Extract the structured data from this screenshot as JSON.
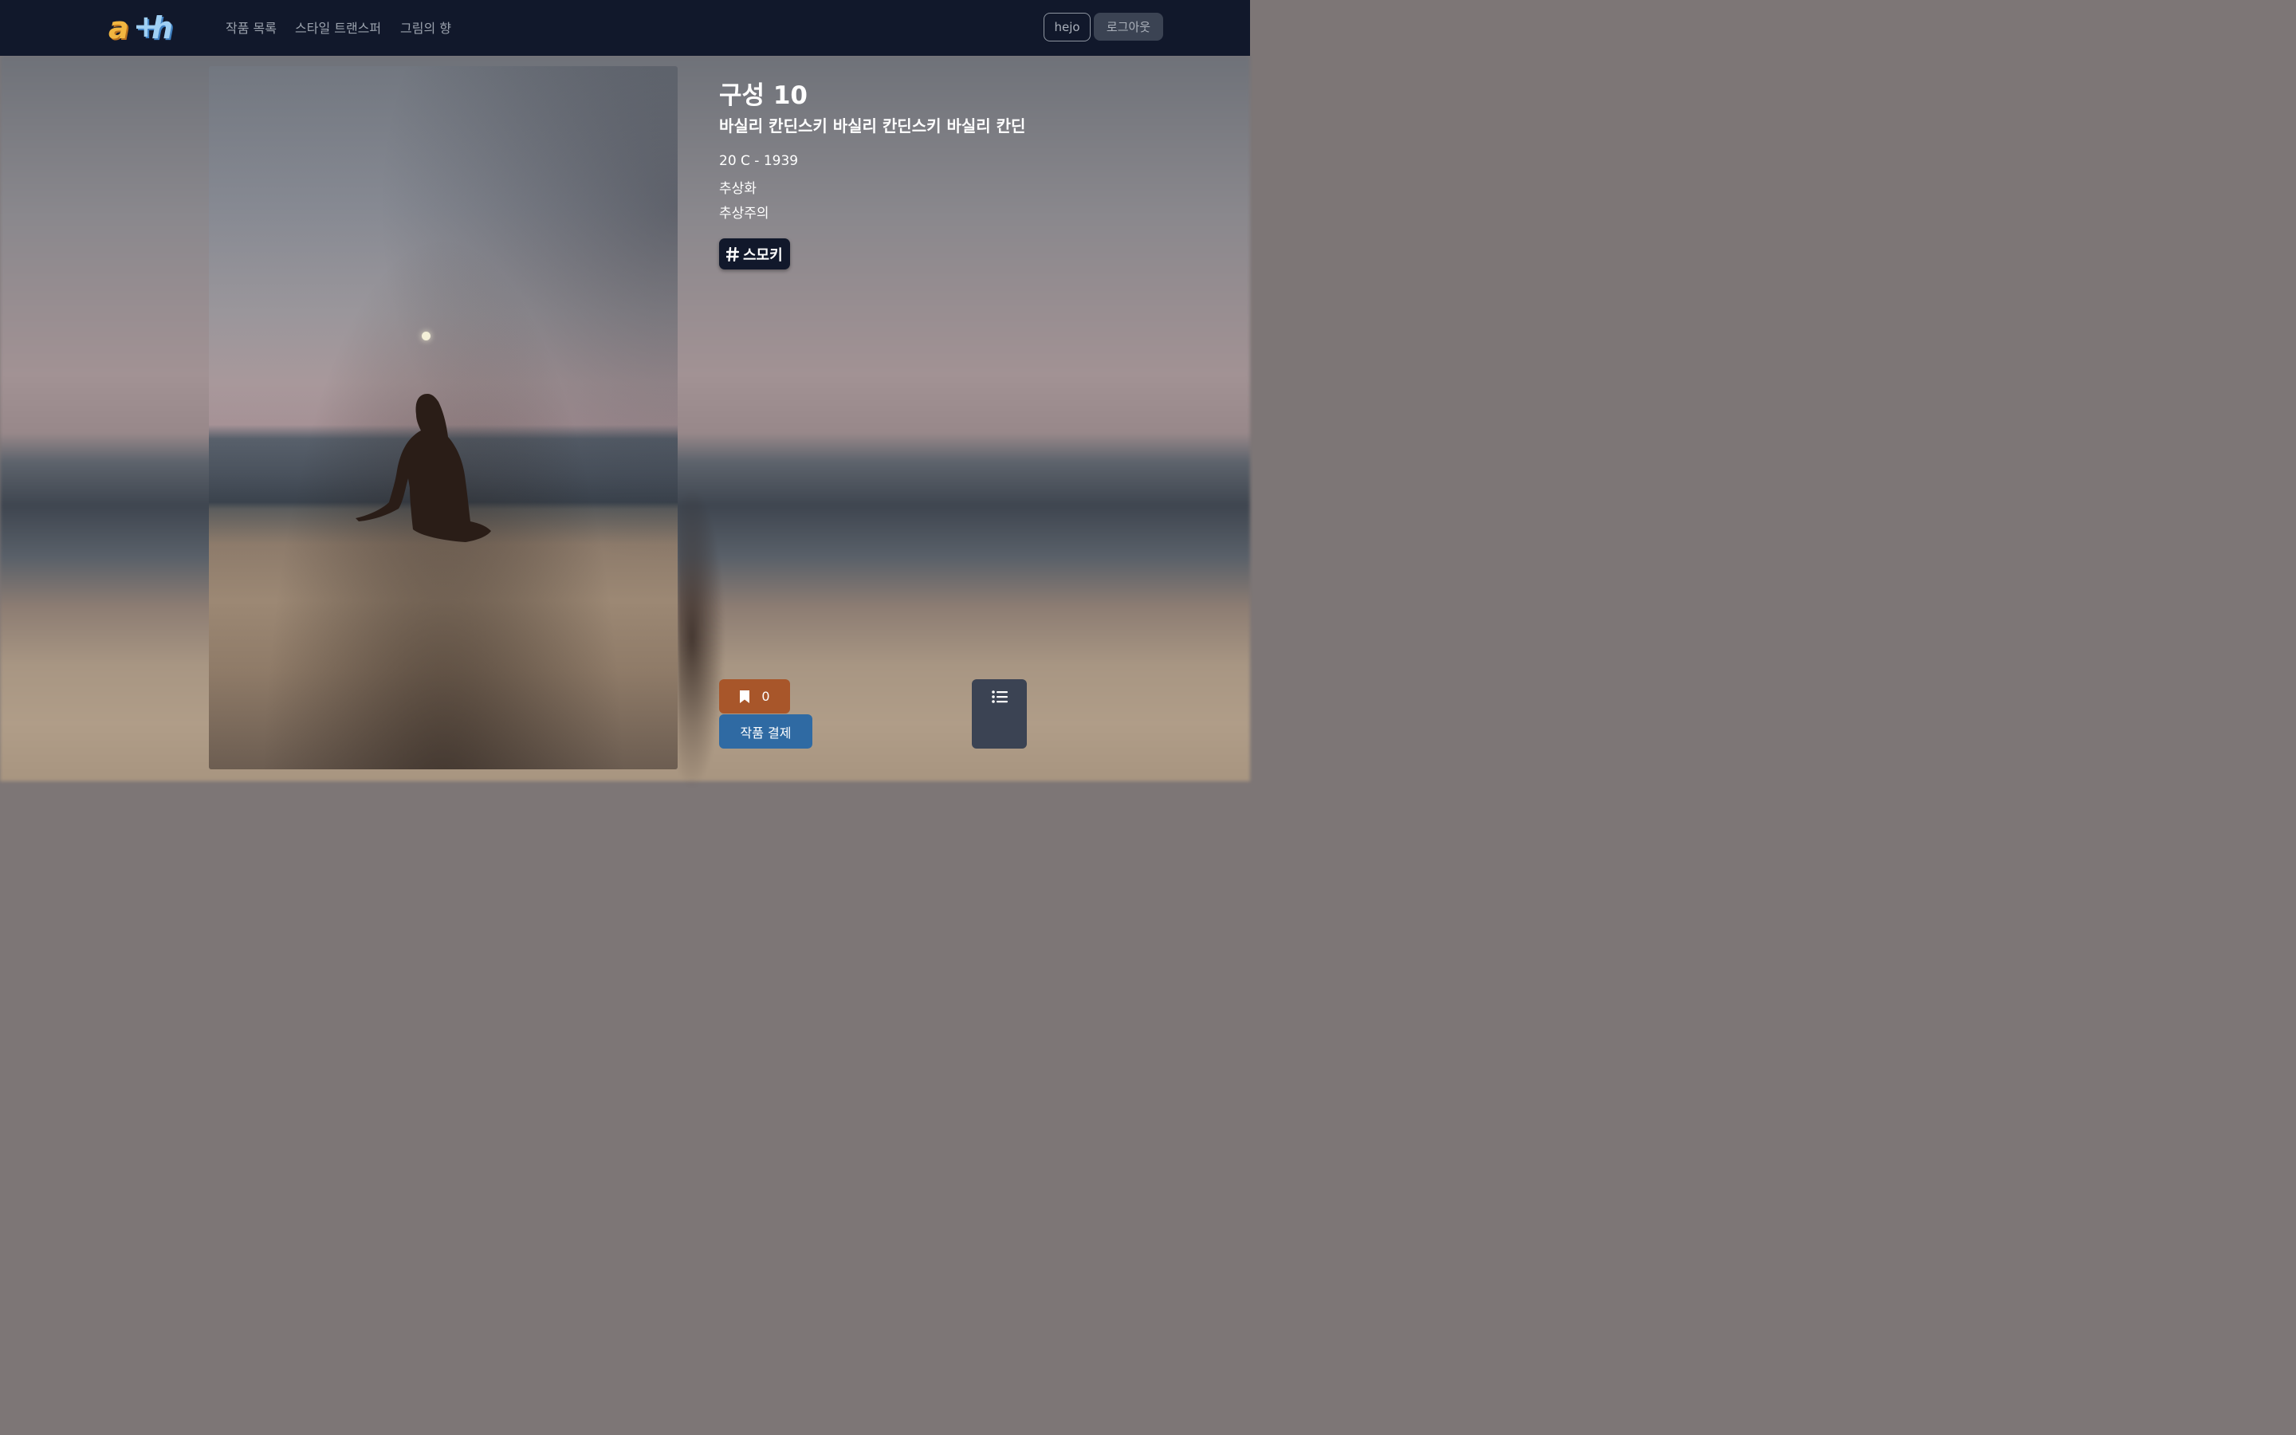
{
  "nav": {
    "logo_alt": "ArtHyang logo",
    "links": [
      "작품 목록",
      "스타일 트랜스퍼",
      "그림의 향"
    ],
    "user_label": "hejo",
    "logout_label": "로그아웃"
  },
  "artwork": {
    "title": "구성 10",
    "artist": "바실리 칸딘스키 바실리 칸딘스키 바실리 칸딘",
    "period": "20 C - 1939",
    "genre": "추상화",
    "movement": "추상주의",
    "tag": "스모키"
  },
  "actions": {
    "bookmark_count": "0",
    "purchase_label": "작품 결제"
  },
  "icons": {
    "bookmark": "bookmark-icon",
    "hash": "hash-icon",
    "list": "list-icon"
  },
  "colors": {
    "navbar": "#11182b",
    "bookmark_button": "#a8562a",
    "purchase_button": "#2f6aa3",
    "list_button": "#3b4353"
  }
}
